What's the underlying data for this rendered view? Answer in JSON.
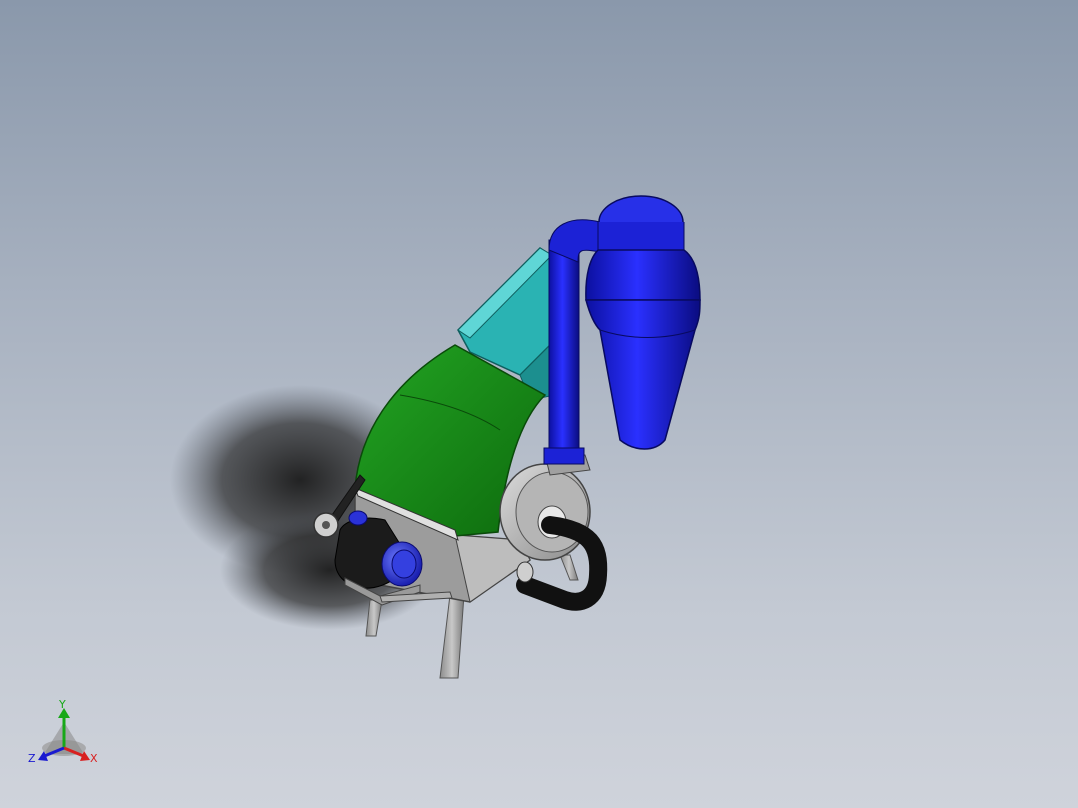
{
  "viewport": {
    "background_top": "#8a98ab",
    "background_bottom": "#cfd3db"
  },
  "model": {
    "colors": {
      "cyclone": "#1c22d6",
      "hopper": "#2ab3b3",
      "housing": "#1f8f1f",
      "frame": "#a9a9a9",
      "motor": "#1a1a1a",
      "pipe": "#121212"
    }
  },
  "triad": {
    "x_label": "X",
    "y_label": "Y",
    "z_label": "Z",
    "x_color": "#d82020",
    "y_color": "#18a818",
    "z_color": "#1a1ad0"
  }
}
